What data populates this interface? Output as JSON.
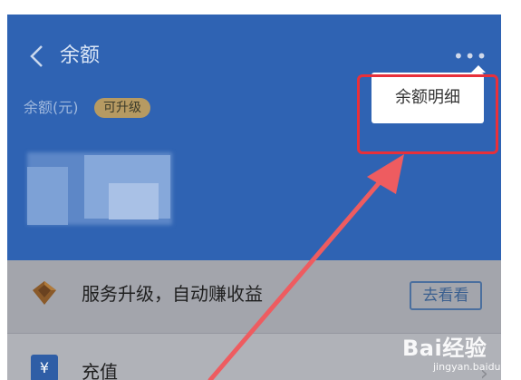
{
  "header": {
    "title": "余额",
    "more_label": "•••",
    "balance_label": "余额(元)",
    "upgrade_badge": "可升级"
  },
  "popup_menu": {
    "items": [
      "余额明细"
    ]
  },
  "list": {
    "service_row": {
      "label": "服务升级，自动赚收益",
      "button": "去看看"
    },
    "recharge_row": {
      "label": "充值",
      "icon_char": "¥"
    }
  },
  "watermark": {
    "main": "Bai经验",
    "sub": "jingyan.baidu.com"
  },
  "colors": {
    "header_bg": "#2f63b3",
    "annotation_red": "#e8303a",
    "badge_gold": "#b69a62"
  }
}
